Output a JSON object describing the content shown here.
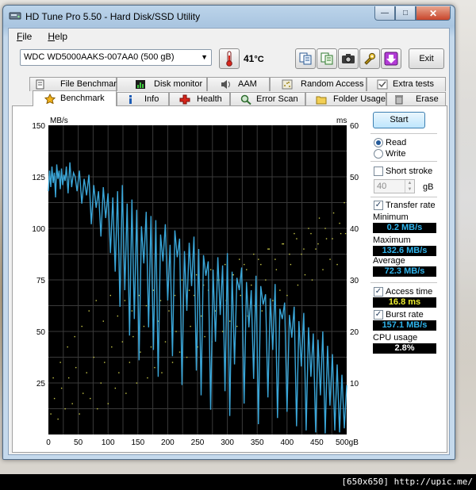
{
  "window": {
    "title": "HD Tune Pro 5.50 - Hard Disk/SSD Utility"
  },
  "menu": {
    "file_key": "F",
    "file_rest": "ile",
    "help_key": "H",
    "help_rest": "elp"
  },
  "toolbar": {
    "drive": "WDC WD5000AAKS-007AA0 (500 gB)",
    "temperature": "41",
    "temp_unit": "°C",
    "exit_label": "Exit"
  },
  "tabs_top": [
    "File Benchmark",
    "Disk monitor",
    "AAM",
    "Random Access",
    "Extra tests"
  ],
  "tabs_bottom": [
    "Benchmark",
    "Info",
    "Health",
    "Error Scan",
    "Folder Usage",
    "Erase"
  ],
  "side": {
    "start_label": "Start",
    "read_label": "Read",
    "write_label": "Write",
    "short_stroke_label": "Short stroke",
    "stroke_value": "40",
    "stroke_unit": "gB",
    "transfer_rate_label": "Transfer rate",
    "minimum_label": "Minimum",
    "minimum_value": "0.2 MB/s",
    "maximum_label": "Maximum",
    "maximum_value": "132.6 MB/s",
    "average_label": "Average",
    "average_value": "72.3 MB/s",
    "access_time_label": "Access time",
    "access_time_value": "16.8 ms",
    "burst_rate_label": "Burst rate",
    "burst_rate_value": "157.1 MB/s",
    "cpu_label": "CPU usage",
    "cpu_value": "2.8%"
  },
  "colors": {
    "chart_bg": "#000000",
    "grid": "#3a3a3a",
    "transfer_line": "#3aa6d8",
    "access_dots": "#c9c94a",
    "value_cyan": "#2fb4ec",
    "value_yellow": "#f0f030",
    "value_white": "#ffffff"
  },
  "watermark": "[650x650] http://upic.me/",
  "chart_data": {
    "type": "line",
    "left_unit": "MB/s",
    "right_unit": "ms",
    "x_ticks": [
      "0",
      "50",
      "100",
      "150",
      "200",
      "250",
      "300",
      "350",
      "400",
      "450",
      "500gB"
    ],
    "y_left_ticks": [
      "150",
      "125",
      "100",
      "75",
      "50",
      "25"
    ],
    "y_right_ticks": [
      "60",
      "50",
      "40",
      "30",
      "20",
      "10"
    ],
    "xlim": [
      0,
      500
    ],
    "ylim_left": [
      0,
      150
    ],
    "ylim_right": [
      0,
      60
    ],
    "grid": true,
    "series": [
      {
        "kind": "transfer_rate",
        "x": [
          0,
          2,
          4,
          6,
          8,
          10,
          12,
          14,
          16,
          18,
          20,
          22,
          24,
          26,
          28,
          30,
          33,
          36,
          39,
          42,
          45,
          48,
          52,
          56,
          60,
          64,
          68,
          72,
          76,
          80,
          84,
          88,
          92,
          96,
          100,
          104,
          108,
          112,
          116,
          120,
          124,
          128,
          132,
          136,
          140,
          144,
          148,
          152,
          156,
          160,
          164,
          168,
          172,
          176,
          180,
          184,
          188,
          192,
          196,
          200,
          204,
          208,
          212,
          216,
          220,
          224,
          228,
          232,
          236,
          240,
          244,
          248,
          252,
          256,
          260,
          264,
          268,
          272,
          276,
          280,
          284,
          288,
          292,
          296,
          300,
          304,
          308,
          312,
          316,
          320,
          324,
          328,
          332,
          336,
          340,
          344,
          348,
          352,
          356,
          360,
          364,
          368,
          372,
          376,
          380,
          384,
          388,
          392,
          396,
          400,
          404,
          408,
          412,
          416,
          420,
          424,
          428,
          432,
          436,
          440,
          444,
          448,
          452,
          456,
          460,
          464,
          468,
          472,
          476,
          480,
          484,
          488,
          492,
          496,
          500
        ],
        "y": [
          118,
          128,
          120,
          130,
          122,
          127,
          115,
          131,
          124,
          128,
          119,
          129,
          121,
          126,
          123,
          130,
          117,
          132,
          120,
          127,
          125,
          118,
          128,
          112,
          124,
          116,
          126,
          102,
          121,
          110,
          118,
          96,
          120,
          105,
          117,
          88,
          115,
          79,
          118,
          62,
          121,
          70,
          112,
          48,
          114,
          56,
          109,
          36,
          101,
          83,
          108,
          52,
          106,
          41,
          104,
          28,
          97,
          84,
          102,
          65,
          92,
          38,
          99,
          86,
          95,
          24,
          89,
          60,
          93,
          72,
          96,
          31,
          90,
          19,
          87,
          77,
          84,
          12,
          80,
          45,
          86,
          58,
          82,
          21,
          88,
          9,
          79,
          34,
          76,
          70,
          81,
          15,
          74,
          52,
          70,
          27,
          77,
          5,
          72,
          63,
          68,
          18,
          66,
          41,
          73,
          8,
          61,
          56,
          64,
          11,
          58,
          47,
          62,
          4,
          55,
          33,
          59,
          2,
          52,
          28,
          49,
          1,
          46,
          19,
          50,
          0.5,
          43,
          14,
          39,
          2,
          34,
          1,
          29,
          3,
          24
        ]
      },
      {
        "kind": "access_time_ms",
        "points": [
          [
            4,
            4
          ],
          [
            10,
            7
          ],
          [
            16,
            3
          ],
          [
            22,
            9
          ],
          [
            28,
            5
          ],
          [
            34,
            11
          ],
          [
            40,
            6
          ],
          [
            46,
            13
          ],
          [
            52,
            4
          ],
          [
            58,
            8
          ],
          [
            64,
            12
          ],
          [
            70,
            7
          ],
          [
            76,
            15
          ],
          [
            82,
            5
          ],
          [
            88,
            10
          ],
          [
            94,
            14
          ],
          [
            100,
            6
          ],
          [
            106,
            17
          ],
          [
            112,
            9
          ],
          [
            118,
            12
          ],
          [
            124,
            18
          ],
          [
            130,
            8
          ],
          [
            136,
            14
          ],
          [
            142,
            19
          ],
          [
            148,
            10
          ],
          [
            154,
            16
          ],
          [
            160,
            21
          ],
          [
            166,
            11
          ],
          [
            172,
            17
          ],
          [
            178,
            13
          ],
          [
            184,
            22
          ],
          [
            190,
            12
          ],
          [
            196,
            18
          ],
          [
            202,
            24
          ],
          [
            208,
            14
          ],
          [
            214,
            20
          ],
          [
            220,
            16
          ],
          [
            226,
            25
          ],
          [
            232,
            15
          ],
          [
            238,
            21
          ],
          [
            244,
            27
          ],
          [
            250,
            17
          ],
          [
            256,
            23
          ],
          [
            262,
            19
          ],
          [
            268,
            28
          ],
          [
            274,
            18
          ],
          [
            280,
            24
          ],
          [
            286,
            30
          ],
          [
            292,
            20
          ],
          [
            298,
            26
          ],
          [
            304,
            22
          ],
          [
            310,
            31
          ],
          [
            316,
            21
          ],
          [
            322,
            27
          ],
          [
            328,
            33
          ],
          [
            334,
            23
          ],
          [
            340,
            29
          ],
          [
            346,
            25
          ],
          [
            352,
            34
          ],
          [
            358,
            24
          ],
          [
            364,
            30
          ],
          [
            370,
            36
          ],
          [
            376,
            26
          ],
          [
            382,
            32
          ],
          [
            388,
            28
          ],
          [
            394,
            37
          ],
          [
            400,
            27
          ],
          [
            406,
            33
          ],
          [
            412,
            39
          ],
          [
            418,
            29
          ],
          [
            424,
            35
          ],
          [
            430,
            31
          ],
          [
            436,
            40
          ],
          [
            442,
            30
          ],
          [
            448,
            36
          ],
          [
            454,
            42
          ],
          [
            460,
            32
          ],
          [
            466,
            38
          ],
          [
            472,
            34
          ],
          [
            478,
            43
          ],
          [
            484,
            33
          ],
          [
            490,
            39
          ],
          [
            496,
            45
          ],
          [
            8,
            11
          ],
          [
            20,
            14
          ],
          [
            32,
            17
          ],
          [
            44,
            19
          ],
          [
            56,
            21
          ],
          [
            68,
            24
          ],
          [
            80,
            26
          ],
          [
            92,
            22
          ],
          [
            104,
            27
          ],
          [
            116,
            23
          ],
          [
            128,
            26
          ],
          [
            140,
            24
          ],
          [
            152,
            27
          ],
          [
            164,
            25
          ],
          [
            176,
            28
          ],
          [
            188,
            26
          ],
          [
            200,
            29
          ],
          [
            212,
            27
          ],
          [
            224,
            30
          ],
          [
            236,
            28
          ],
          [
            248,
            31
          ],
          [
            260,
            29
          ],
          [
            272,
            32
          ],
          [
            284,
            30
          ],
          [
            296,
            33
          ],
          [
            308,
            31
          ],
          [
            320,
            34
          ],
          [
            332,
            32
          ],
          [
            344,
            35
          ],
          [
            356,
            33
          ],
          [
            368,
            36
          ],
          [
            380,
            34
          ],
          [
            392,
            37
          ],
          [
            404,
            35
          ],
          [
            416,
            38
          ],
          [
            428,
            36
          ],
          [
            440,
            39
          ],
          [
            452,
            37
          ],
          [
            464,
            40
          ],
          [
            476,
            38
          ],
          [
            488,
            41
          ],
          [
            498,
            39
          ]
        ]
      }
    ]
  }
}
